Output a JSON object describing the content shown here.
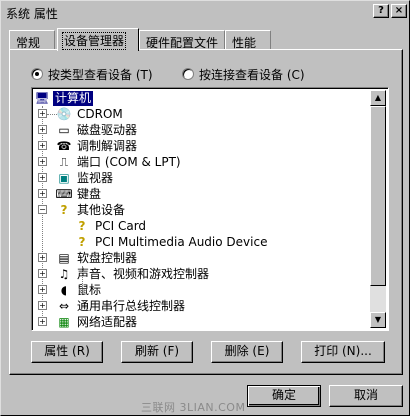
{
  "window": {
    "title": "系统 属性",
    "help_label": "?",
    "close_label": "×"
  },
  "tabs": [
    {
      "label": "常规",
      "active": false
    },
    {
      "label": "设备管理器",
      "active": true
    },
    {
      "label": "硬件配置文件",
      "active": false
    },
    {
      "label": "性能",
      "active": false
    }
  ],
  "view_options": {
    "by_type": {
      "label": "按类型查看设备 (T)",
      "selected": true
    },
    "by_connection": {
      "label": "按连接查看设备 (C)",
      "selected": false
    }
  },
  "tree": {
    "root": {
      "label": "计算机",
      "icon": "computer-icon",
      "selected": true
    },
    "items": [
      {
        "label": "CDROM",
        "icon": "cdrom-icon",
        "expanded": false
      },
      {
        "label": "磁盘驱动器",
        "icon": "disk-drive-icon",
        "expanded": false
      },
      {
        "label": "调制解调器",
        "icon": "modem-icon",
        "expanded": false
      },
      {
        "label": "端口 (COM & LPT)",
        "icon": "port-icon",
        "expanded": false
      },
      {
        "label": "监视器",
        "icon": "monitor-icon",
        "expanded": false
      },
      {
        "label": "键盘",
        "icon": "keyboard-icon",
        "expanded": false
      },
      {
        "label": "其他设备",
        "icon": "unknown-device-icon",
        "expanded": true,
        "children": [
          {
            "label": "PCI Card",
            "icon": "unknown-device-icon"
          },
          {
            "label": "PCI Multimedia Audio Device",
            "icon": "unknown-device-icon"
          }
        ]
      },
      {
        "label": "软盘控制器",
        "icon": "floppy-controller-icon",
        "expanded": false
      },
      {
        "label": "声音、视频和游戏控制器",
        "icon": "sound-icon",
        "expanded": false
      },
      {
        "label": "鼠标",
        "icon": "mouse-icon",
        "expanded": false
      },
      {
        "label": "通用串行总线控制器",
        "icon": "usb-icon",
        "expanded": false
      },
      {
        "label": "网络适配器",
        "icon": "network-adapter-icon",
        "expanded": false
      }
    ]
  },
  "buttons": {
    "properties": "属性 (R)",
    "refresh": "刷新 (F)",
    "remove": "删除 (E)",
    "print": "打印 (N)...",
    "ok": "确定",
    "cancel": "取消"
  },
  "watermark": "三联网 3LIAN.COM"
}
